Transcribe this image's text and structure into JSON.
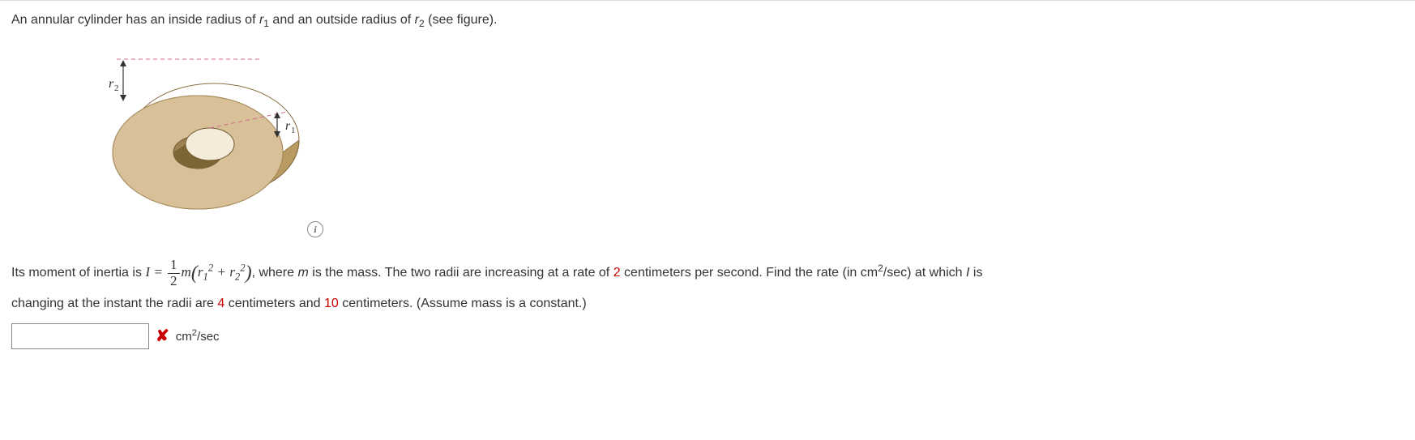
{
  "intro": {
    "part1": "An annular cylinder has an inside radius of ",
    "r1": "r",
    "r1sub": "1",
    "part2": " and an outside radius of ",
    "r2": "r",
    "r2sub": "2",
    "part3": " (see figure)."
  },
  "figure": {
    "r2_label": "r",
    "r2_sub": "2",
    "r1_label": "r",
    "r1_sub": "1"
  },
  "info_icon": "i",
  "q": {
    "p1": "Its moment of inertia is ",
    "I": "I",
    "eq": " = ",
    "frac_num": "1",
    "frac_den": "2",
    "m": "m",
    "r1": "r",
    "r1sub": "1",
    "sq": "2",
    "plus": " + ",
    "r2": "r",
    "r2sub": "2",
    "p2": ", where ",
    "m2": "m",
    "p3": " is the mass. The two radii are increasing at a rate of ",
    "rate": "2",
    "p4": " centimeters per second. Find the rate (in cm",
    "unitSup": "2",
    "p5": "/sec) at which ",
    "I2": "I",
    "p6": " is",
    "p7": "changing at the instant the radii are ",
    "val1": "4",
    "p8": " centimeters and ",
    "val2": "10",
    "p9": " centimeters. (Assume mass is a constant.)"
  },
  "answer": {
    "value": "",
    "unit_prefix": "cm",
    "unit_sup": "2",
    "unit_suffix": "/sec"
  }
}
